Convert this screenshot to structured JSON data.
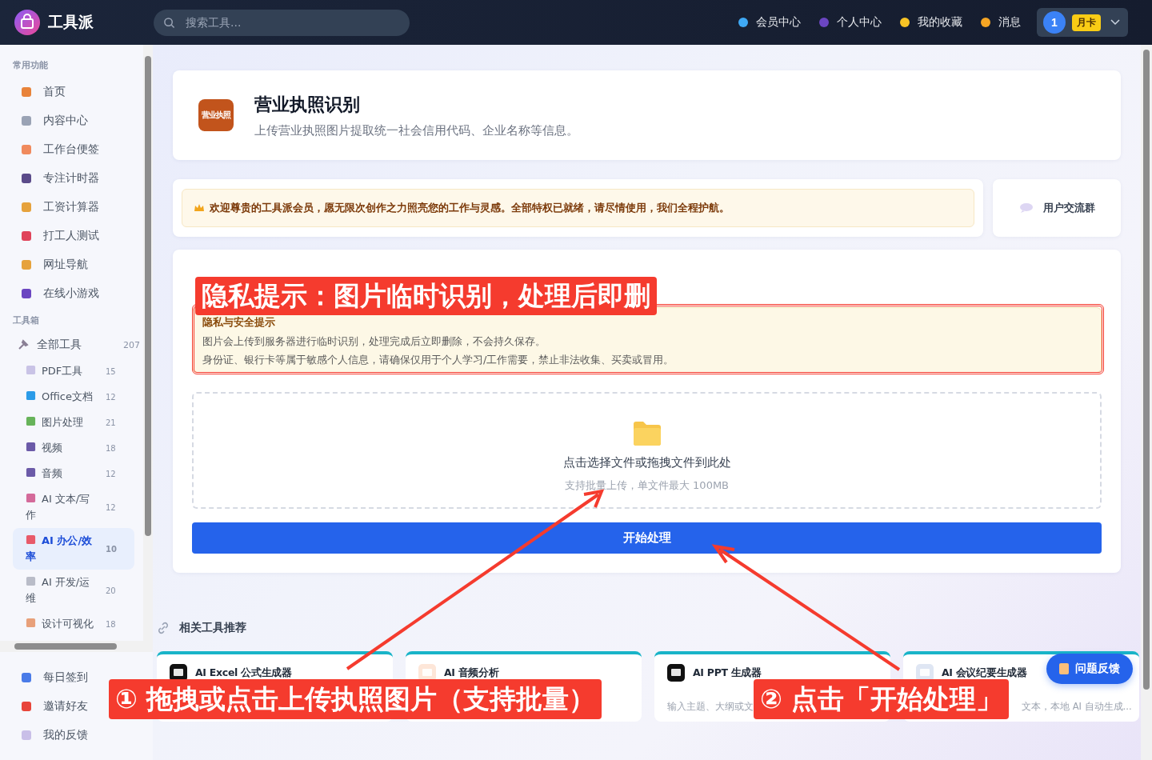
{
  "app": {
    "name": "工具派"
  },
  "search": {
    "placeholder": "搜索工具..."
  },
  "nav": [
    {
      "label": "会员中心"
    },
    {
      "label": "个人中心"
    },
    {
      "label": "我的收藏"
    },
    {
      "label": "消息"
    }
  ],
  "user": {
    "avatar": "1",
    "badge": "月卡"
  },
  "sidebar": {
    "sections": [
      {
        "title": "常用功能",
        "items": [
          {
            "label": "首页"
          },
          {
            "label": "内容中心"
          },
          {
            "label": "工作台便签"
          },
          {
            "label": "专注计时器"
          },
          {
            "label": "工资计算器"
          },
          {
            "label": "打工人测试"
          },
          {
            "label": "网址导航"
          },
          {
            "label": "在线小游戏"
          }
        ]
      },
      {
        "title": "工具箱",
        "all": {
          "label": "全部工具",
          "count": "207"
        },
        "items": [
          {
            "label": "PDF工具",
            "count": "15",
            "selected": false
          },
          {
            "label": "Office文档",
            "count": "12",
            "selected": false
          },
          {
            "label": "图片处理",
            "count": "21",
            "selected": false
          },
          {
            "label": "视频",
            "count": "18",
            "selected": false
          },
          {
            "label": "音频",
            "count": "12",
            "selected": false
          },
          {
            "label": "AI 文本/写作",
            "count": "12",
            "selected": false
          },
          {
            "label": "AI 办公/效率",
            "count": "10",
            "selected": true
          },
          {
            "label": "AI 开发/运维",
            "count": "20",
            "selected": false
          },
          {
            "label": "设计可视化",
            "count": "18",
            "selected": false
          }
        ]
      }
    ],
    "bottom": [
      {
        "label": "每日签到"
      },
      {
        "label": "邀请好友"
      },
      {
        "label": "我的反馈"
      }
    ]
  },
  "header": {
    "icon_text": "营业执照",
    "title": "营业执照识别",
    "subtitle": "上传营业执照图片提取统一社会信用代码、企业名称等信息。"
  },
  "welcome": "欢迎尊贵的工具派会员，愿无限次创作之力照亮您的工作与灵感。全部特权已就绪，请尽情使用，我们全程护航。",
  "group_button": "用户交流群",
  "upload": {
    "notice_title": "隐私与安全提示",
    "notice_lines": [
      "图片会上传到服务器进行临时识别，处理完成后立即删除，不会持久保存。",
      "身份证、银行卡等属于敏感个人信息，请确保仅用于个人学习/工作需要，禁止非法收集、买卖或冒用。"
    ],
    "drop_text": "点击选择文件或拖拽文件到此处",
    "drop_hint": "支持批量上传，单文件最大 100MB",
    "button": "开始处理"
  },
  "related": {
    "title": "相关工具推荐",
    "cards": [
      {
        "title": "AI Excel 公式生成器",
        "kind": "excel"
      },
      {
        "title": "AI 音频分析",
        "kind": "audio"
      },
      {
        "title": "AI PPT 生成器",
        "desc": "输入主题、大纲或文",
        "kind": "ppt"
      },
      {
        "title": "AI 会议纪要生成器",
        "desc": "文本，本地 AI 自动生成...",
        "kind": "doc"
      }
    ]
  },
  "feedback_button": "问题反馈",
  "annotations": [
    {
      "text": "隐私提示：图片临时识别，处理后即删",
      "kind": "privacy"
    },
    {
      "text": "① 拖拽或点击上传执照图片（支持批量）",
      "kind": "upload"
    },
    {
      "text": "② 点击「开始处理」",
      "kind": "process"
    }
  ]
}
